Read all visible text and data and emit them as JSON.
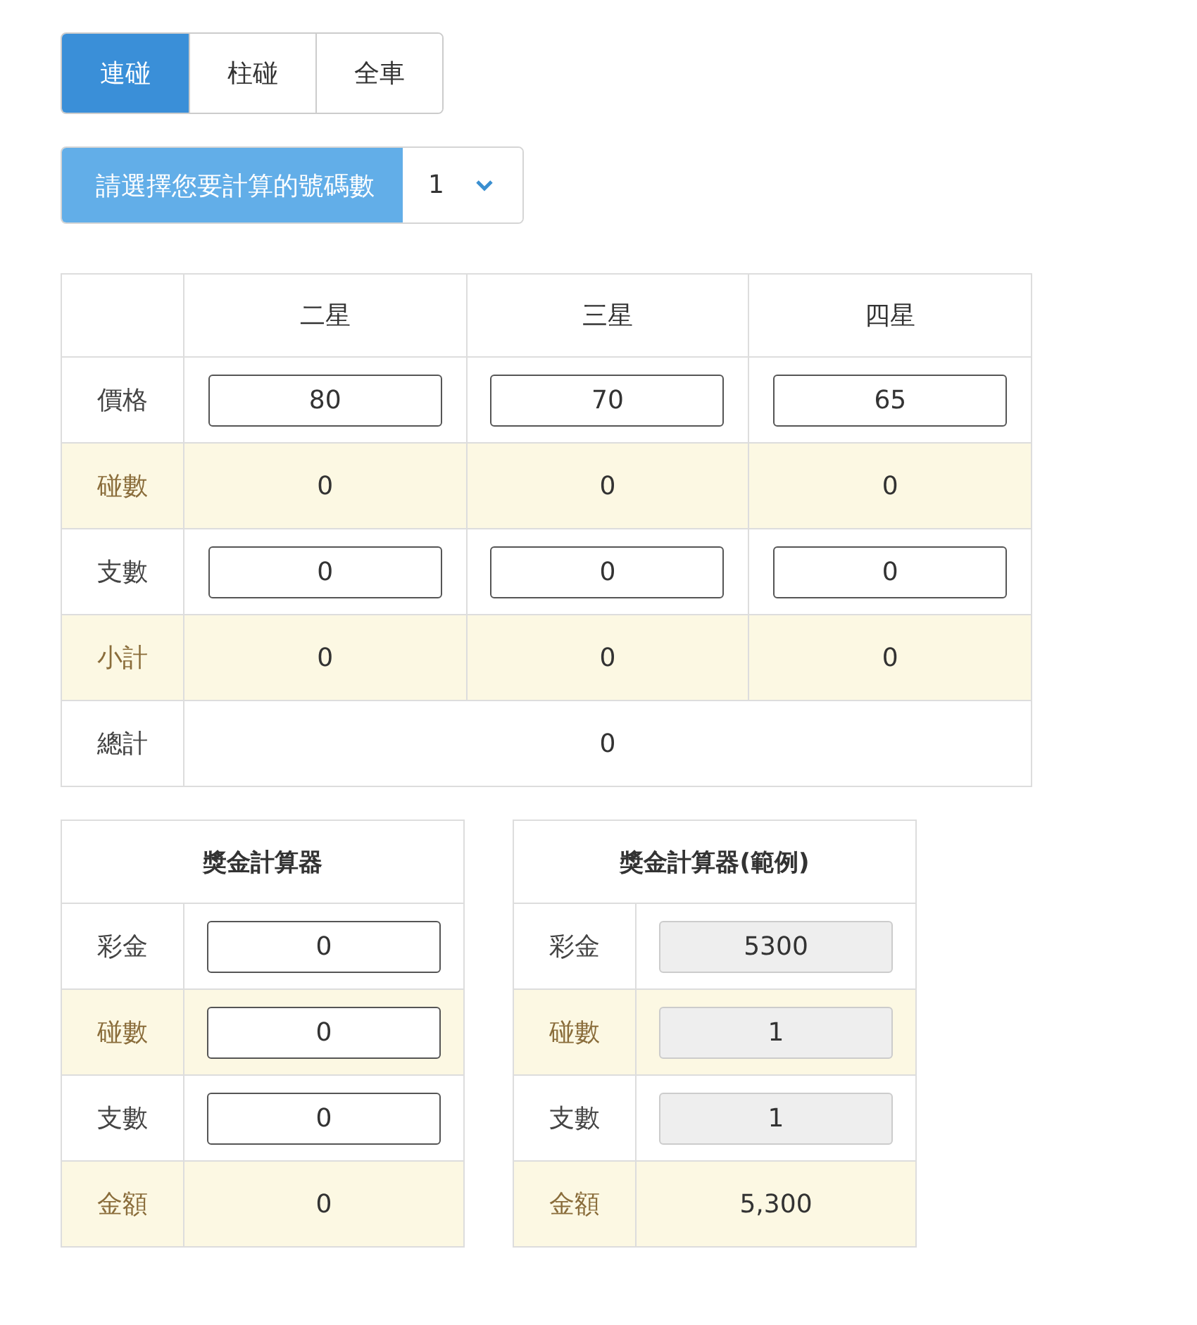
{
  "tabs": [
    {
      "label": "連碰",
      "selected": true
    },
    {
      "label": "柱碰",
      "selected": false
    },
    {
      "label": "全車",
      "selected": false
    }
  ],
  "count_select": {
    "label": "請選擇您要計算的號碼數",
    "value": "1"
  },
  "table": {
    "columns": [
      "二星",
      "三星",
      "四星"
    ],
    "rows": [
      {
        "label": "價格",
        "highlighted": false,
        "kind": "input",
        "cells": [
          "80",
          "70",
          "65"
        ]
      },
      {
        "label": "碰數",
        "highlighted": true,
        "kind": "text",
        "cells": [
          "0",
          "0",
          "0"
        ]
      },
      {
        "label": "支數",
        "highlighted": false,
        "kind": "input",
        "cells": [
          "0",
          "0",
          "0"
        ]
      },
      {
        "label": "小計",
        "highlighted": true,
        "kind": "text",
        "cells": [
          "0",
          "0",
          "0"
        ]
      },
      {
        "label": "總計",
        "highlighted": false,
        "kind": "total",
        "cells": [
          {
            "text": "0",
            "colspan": 3
          }
        ]
      }
    ]
  },
  "calculators": [
    {
      "title": "獎金計算器",
      "rows": [
        {
          "label": "彩金",
          "highlighted": false,
          "kind": "input",
          "value": "0",
          "disabled": false
        },
        {
          "label": "碰數",
          "highlighted": true,
          "kind": "input",
          "value": "0",
          "disabled": false
        },
        {
          "label": "支數",
          "highlighted": false,
          "kind": "input",
          "value": "0",
          "disabled": false
        },
        {
          "label": "金額",
          "highlighted": true,
          "kind": "text",
          "value": "0"
        }
      ]
    },
    {
      "title": "獎金計算器(範例)",
      "rows": [
        {
          "label": "彩金",
          "highlighted": false,
          "kind": "input",
          "value": "5300",
          "disabled": true
        },
        {
          "label": "碰數",
          "highlighted": true,
          "kind": "input",
          "value": "1",
          "disabled": true
        },
        {
          "label": "支數",
          "highlighted": false,
          "kind": "input",
          "value": "1",
          "disabled": true
        },
        {
          "label": "金額",
          "highlighted": true,
          "kind": "text",
          "value": "5,300"
        }
      ]
    }
  ]
}
